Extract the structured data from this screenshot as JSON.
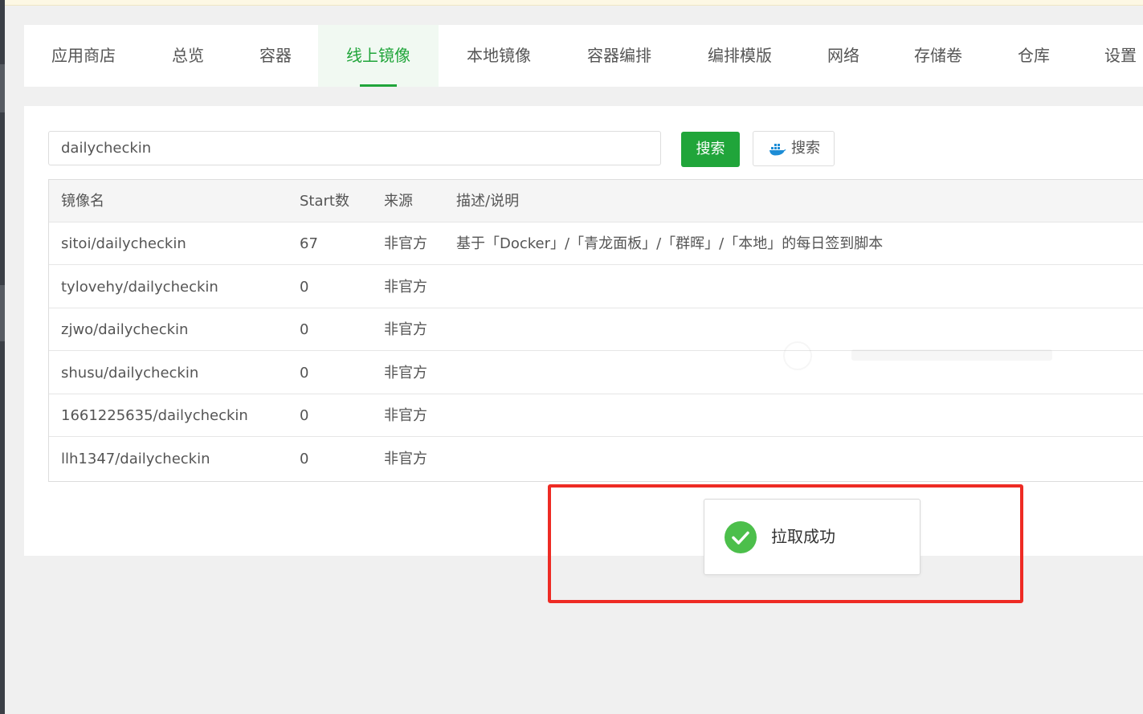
{
  "tabs": [
    {
      "label": "应用商店"
    },
    {
      "label": "总览"
    },
    {
      "label": "容器"
    },
    {
      "label": "线上镜像"
    },
    {
      "label": "本地镜像"
    },
    {
      "label": "容器编排"
    },
    {
      "label": "编排模版"
    },
    {
      "label": "网络"
    },
    {
      "label": "存储卷"
    },
    {
      "label": "仓库"
    },
    {
      "label": "设置"
    }
  ],
  "active_tab": "线上镜像",
  "search": {
    "value": "dailycheckin",
    "button_label": "搜索",
    "docker_button_label": "搜索",
    "docker_icon": "docker-whale-icon"
  },
  "table": {
    "headers": [
      "镜像名",
      "Start数",
      "来源",
      "描述/说明"
    ],
    "rows": [
      {
        "name": "sitoi/dailycheckin",
        "stars": "67",
        "source": "非官方",
        "desc": "基于「Docker」/「青龙面板」/「群晖」/「本地」的每日签到脚本"
      },
      {
        "name": "tylovehy/dailycheckin",
        "stars": "0",
        "source": "非官方",
        "desc": ""
      },
      {
        "name": "zjwo/dailycheckin",
        "stars": "0",
        "source": "非官方",
        "desc": ""
      },
      {
        "name": "shusu/dailycheckin",
        "stars": "0",
        "source": "非官方",
        "desc": ""
      },
      {
        "name": "1661225635/dailycheckin",
        "stars": "0",
        "source": "非官方",
        "desc": ""
      },
      {
        "name": "llh1347/dailycheckin",
        "stars": "0",
        "source": "非官方",
        "desc": ""
      }
    ]
  },
  "toast": {
    "message": "拉取成功",
    "icon": "check-circle-icon"
  },
  "colors": {
    "accent": "#20a53a",
    "success": "#4cbf4b",
    "highlight": "#ee2b24"
  }
}
